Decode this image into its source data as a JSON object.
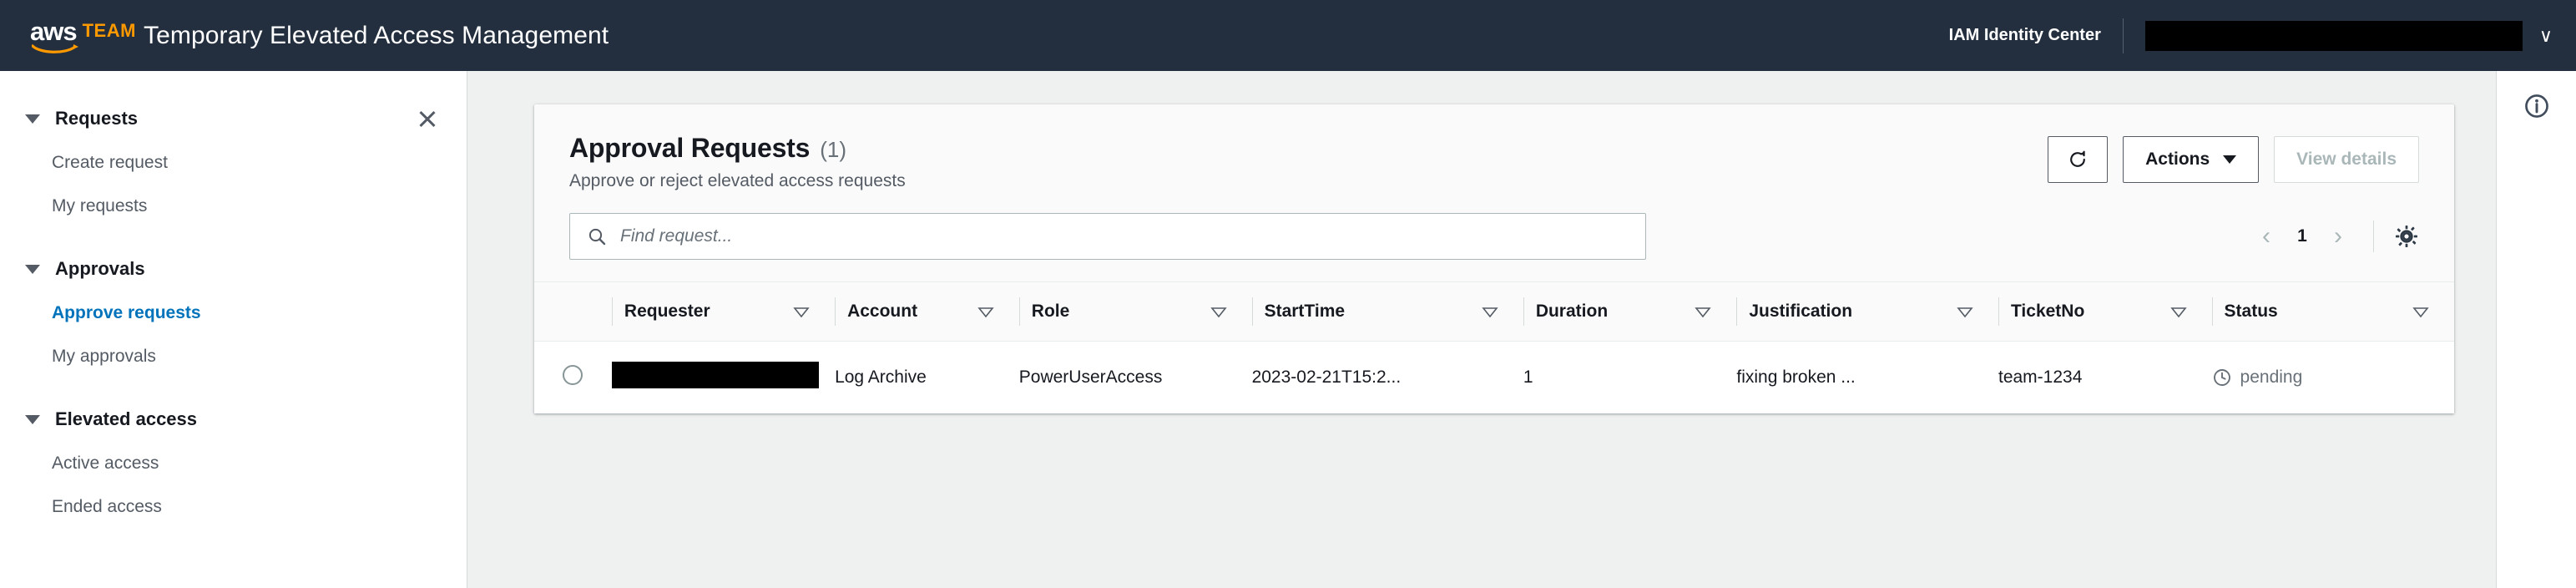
{
  "topnav": {
    "logo_aws": "aws",
    "logo_team": "TEAM",
    "app_title": "Temporary Elevated Access Management",
    "identity_label": "IAM Identity Center",
    "user_value": "",
    "user_redacted": true,
    "chevron": "∨",
    "background_color": "#232f3e",
    "accent_color": "#ff9900"
  },
  "sidebar": {
    "close_label": "Close navigation",
    "groups": [
      {
        "label": "Requests",
        "expanded": true,
        "items": [
          {
            "label": "Create request",
            "active": false
          },
          {
            "label": "My requests",
            "active": false
          }
        ]
      },
      {
        "label": "Approvals",
        "expanded": true,
        "items": [
          {
            "label": "Approve requests",
            "active": true
          },
          {
            "label": "My approvals",
            "active": false
          }
        ]
      },
      {
        "label": "Elevated access",
        "expanded": true,
        "items": [
          {
            "label": "Active access",
            "active": false
          },
          {
            "label": "Ended access",
            "active": false
          }
        ]
      }
    ],
    "active_color": "#0073bb"
  },
  "card": {
    "title": "Approval Requests",
    "count": "(1)",
    "subtitle": "Approve or reject elevated access requests",
    "buttons": {
      "refresh_label": "Refresh",
      "actions_label": "Actions",
      "view_details_label": "View details",
      "view_details_disabled": true
    }
  },
  "search": {
    "placeholder": "Find request...",
    "value": "",
    "icon": "search-icon"
  },
  "pagination": {
    "prev": "‹",
    "page": "1",
    "next": "›",
    "prev_disabled": true,
    "next_disabled": true,
    "settings_icon": "gear-icon"
  },
  "table": {
    "columns": [
      "Requester",
      "Account",
      "Role",
      "StartTime",
      "Duration",
      "Justification",
      "TicketNo",
      "Status"
    ],
    "rows": [
      {
        "selected": false,
        "requester": "",
        "requester_redacted": true,
        "account": "Log Archive",
        "role": "PowerUserAccess",
        "start_time": "2023-02-21T15:2...",
        "duration": "1",
        "justification": "fixing broken ...",
        "ticket_no": "team-1234",
        "status": "pending",
        "status_icon": "clock-icon",
        "status_color": "#687078"
      }
    ]
  },
  "help_panel": {
    "info_icon": "info-icon"
  }
}
